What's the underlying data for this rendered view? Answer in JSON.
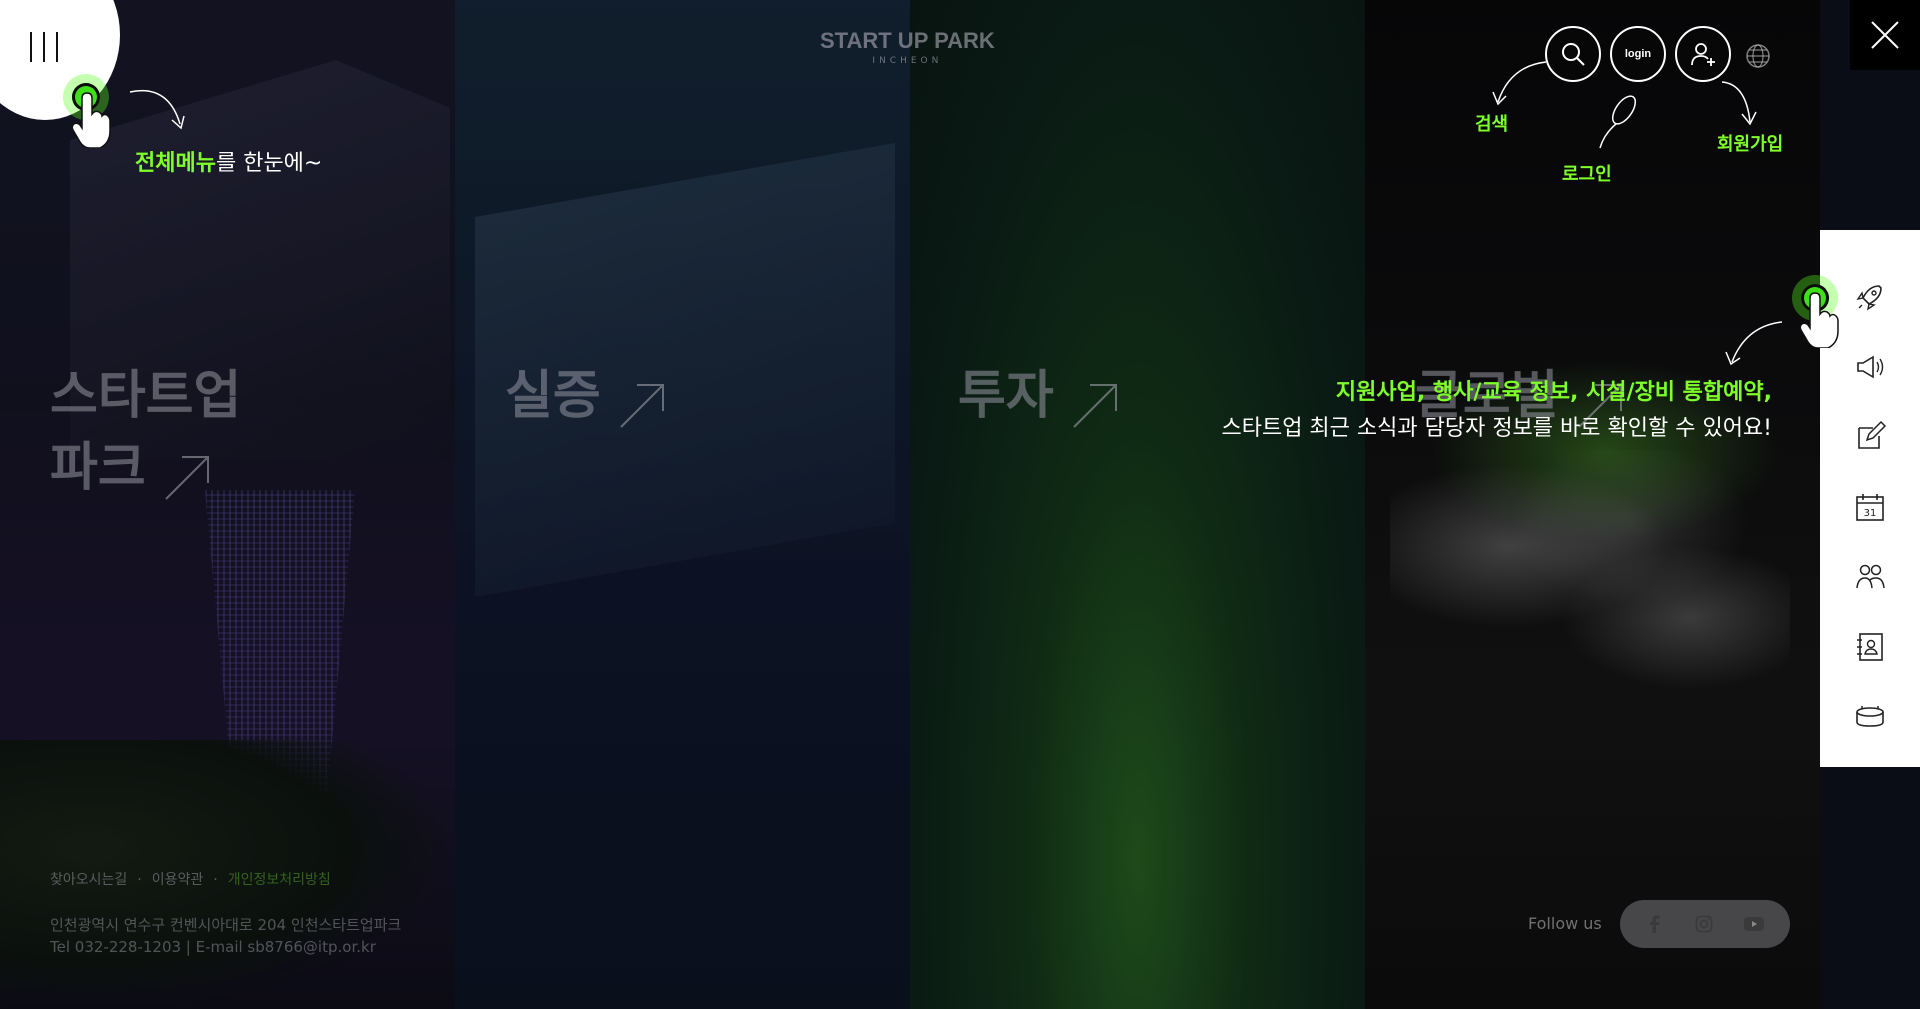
{
  "header": {
    "logo_main": "START UP PARK",
    "logo_sub": "INCHEON",
    "login_label": "login"
  },
  "menu_tip": {
    "highlight": "전체메뉴",
    "rest": "를 한눈에~"
  },
  "header_tips": {
    "search": "검색",
    "login": "로그인",
    "signup": "회원가입"
  },
  "panels": [
    {
      "line1": "스타트업",
      "line2": "파크"
    },
    {
      "line1": "실증"
    },
    {
      "line1": "투자"
    },
    {
      "line1": "글로벌"
    }
  ],
  "intro": {
    "line1": "지원사업, 행사/교육 정보, 시설/장비 통합예약,",
    "line2": "스타트업 최근 소식과 담당자 정보를 바로 확인할 수 있어요!"
  },
  "quickbar": {
    "items": [
      "rocket-icon",
      "megaphone-icon",
      "edit-icon",
      "calendar-icon",
      "people-icon",
      "contact-icon",
      "facility-icon"
    ],
    "calendar_day": "31"
  },
  "footer": {
    "link_directions": "찾아오시는길",
    "link_terms": "이용약관",
    "link_privacy": "개인정보처리방침",
    "address": "인천광역시 연수구 컨벤시아대로 204 인천스타트업파크",
    "contact": "Tel 032-228-1203 | E-mail sb8766@itp.or.kr",
    "follow_label": "Follow us",
    "social": [
      "facebook-icon",
      "instagram-icon",
      "youtube-icon"
    ]
  },
  "colors": {
    "accent_green": "#7fff2a",
    "quickbar_bg": "#ffffff"
  }
}
